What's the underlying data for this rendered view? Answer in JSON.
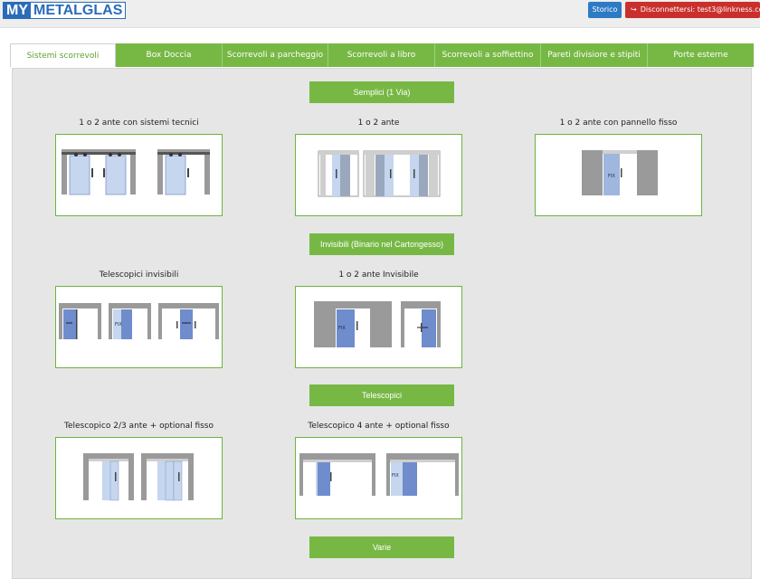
{
  "header": {
    "logo_my": "MY",
    "logo_rest": "METALGLAS",
    "storico_label": "Storico",
    "logout_icon": "sign-out-icon",
    "logout_label": "Disconnettersi: test3@linkness.com"
  },
  "tabs": [
    {
      "label": "Sistemi scorrevoli",
      "active": true
    },
    {
      "label": "Box Doccia",
      "active": false
    },
    {
      "label": "Scorrevoli a parcheggio",
      "active": false
    },
    {
      "label": "Scorrevoli a libro",
      "active": false
    },
    {
      "label": "Scorrevoli a soffiettino",
      "active": false
    },
    {
      "label": "Pareti divisiore e stipiti",
      "active": false
    },
    {
      "label": "Porte esterne",
      "active": false
    }
  ],
  "sections": [
    {
      "title": "Semplici (1 Via)",
      "items": [
        {
          "label": "1 o 2 ante con sistemi tecnici",
          "image": "two-doors-technical-illustration"
        },
        {
          "label": "1 o 2 ante",
          "image": "one-two-doors-illustration"
        },
        {
          "label": "1 o 2 ante con pannello fisso",
          "image": "door-with-fixed-panel-illustration",
          "fix_label": "FIX"
        }
      ]
    },
    {
      "title": "Invisibili (Binario nel Cartongesso)",
      "items": [
        {
          "label": "Telescopici invisibili",
          "image": "invisible-telescopic-illustration",
          "fix_label": "FIX"
        },
        {
          "label": "1 o 2 ante Invisibile",
          "image": "invisible-doors-illustration",
          "fix_label": "FIX"
        }
      ]
    },
    {
      "title": "Telescopici",
      "items": [
        {
          "label": "Telescopico 2/3 ante + optional fisso",
          "image": "telescopic-2-3-illustration"
        },
        {
          "label": "Telescopico 4 ante + optional fisso",
          "image": "telescopic-4-illustration",
          "fix_label": "FIX"
        }
      ]
    },
    {
      "title": "Varie",
      "items": []
    }
  ],
  "colors": {
    "accent_green": "#77b845",
    "brand_blue": "#2a6cb8",
    "logout_red": "#c9302c",
    "glass_blue": "#c5d6ee",
    "door_blue": "#6f8ccc"
  }
}
